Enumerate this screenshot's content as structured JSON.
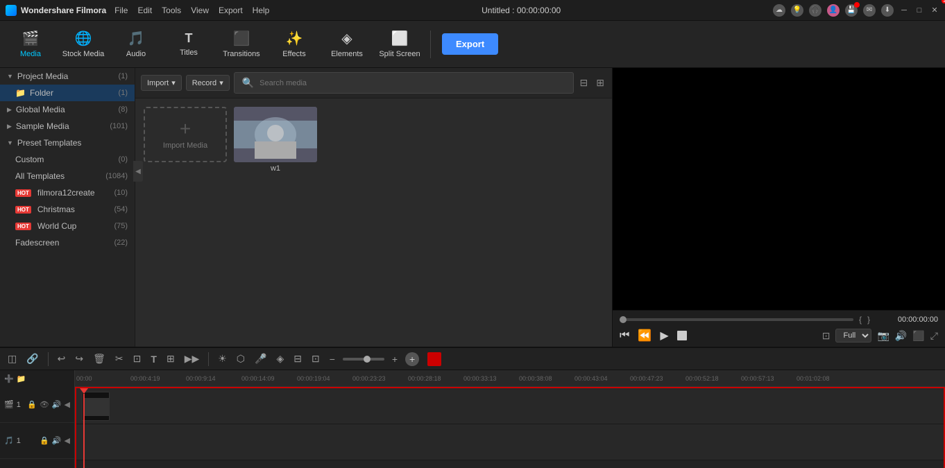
{
  "app": {
    "name": "Wondershare Filmora",
    "title": "Untitled : 00:00:00:00"
  },
  "menu": {
    "items": [
      "File",
      "Edit",
      "Tools",
      "View",
      "Export",
      "Help"
    ]
  },
  "toolbar": {
    "items": [
      {
        "id": "media",
        "label": "Media",
        "icon": "🎬",
        "active": true
      },
      {
        "id": "stock",
        "label": "Stock Media",
        "icon": "🌐"
      },
      {
        "id": "audio",
        "label": "Audio",
        "icon": "🎵"
      },
      {
        "id": "titles",
        "label": "Titles",
        "icon": "T"
      },
      {
        "id": "transitions",
        "label": "Transitions",
        "icon": "⊞"
      },
      {
        "id": "effects",
        "label": "Effects",
        "icon": "✨"
      },
      {
        "id": "elements",
        "label": "Elements",
        "icon": "◈"
      },
      {
        "id": "splitscreen",
        "label": "Split Screen",
        "icon": "⊟"
      }
    ],
    "export_label": "Export"
  },
  "left_panel": {
    "sections": [
      {
        "id": "project-media",
        "label": "Project Media",
        "count": "(1)",
        "expanded": true,
        "indent": 0
      },
      {
        "id": "folder",
        "label": "Folder",
        "count": "(1)",
        "indent": 1,
        "selected": true
      },
      {
        "id": "global-media",
        "label": "Global Media",
        "count": "(8)",
        "indent": 0
      },
      {
        "id": "sample-media",
        "label": "Sample Media",
        "count": "(101)",
        "indent": 0
      },
      {
        "id": "preset-templates",
        "label": "Preset Templates",
        "count": "",
        "indent": 0,
        "expanded": true
      },
      {
        "id": "custom",
        "label": "Custom",
        "count": "(0)",
        "indent": 1
      },
      {
        "id": "all-templates",
        "label": "All Templates",
        "count": "(1084)",
        "indent": 1
      },
      {
        "id": "filmora12create",
        "label": "filmora12create",
        "count": "(10)",
        "indent": 1,
        "hot": true
      },
      {
        "id": "christmas",
        "label": "Christmas",
        "count": "(54)",
        "indent": 1,
        "hot": true
      },
      {
        "id": "world-cup",
        "label": "World Cup",
        "count": "(75)",
        "indent": 1,
        "hot": true
      },
      {
        "id": "fadescreen",
        "label": "Fadescreen",
        "count": "(22)",
        "indent": 1
      }
    ]
  },
  "media_panel": {
    "import_label": "Import",
    "record_label": "Record",
    "search_placeholder": "Search media",
    "import_media_label": "Import Media",
    "media_items": [
      {
        "id": "w1",
        "name": "w1",
        "has_thumb": true
      }
    ]
  },
  "preview": {
    "time": "00:00:00:00",
    "quality": "Full",
    "brackets": [
      "{",
      "}"
    ]
  },
  "timeline": {
    "time_markers": [
      "00:00",
      "00:00:4:19",
      "00:00:9:14",
      "00:00:14:09",
      "00:00:19:04",
      "00:00:23:23",
      "00:00:28:18",
      "00:00:33:13",
      "00:00:38:08",
      "00:00:43:04",
      "00:00:47:23",
      "00:00:52:18",
      "00:00:57:13",
      "00:01:02:08"
    ],
    "tracks": [
      {
        "id": "video1",
        "type": "video",
        "num": "1"
      },
      {
        "id": "audio1",
        "type": "audio",
        "num": "1"
      }
    ]
  },
  "icons": {
    "undo": "↩",
    "redo": "↪",
    "delete": "🗑",
    "cut": "✂",
    "crop": "⊡",
    "text": "T",
    "adjust": "⊞",
    "speed": "▶▶",
    "sun": "☀",
    "shield": "⬡",
    "mic": "🎤",
    "sticker": "◈",
    "grid": "⊞",
    "minus": "−",
    "plus": "+",
    "snap": "◫",
    "link": "🔗",
    "add_track": "➕",
    "collapse": "◀"
  }
}
